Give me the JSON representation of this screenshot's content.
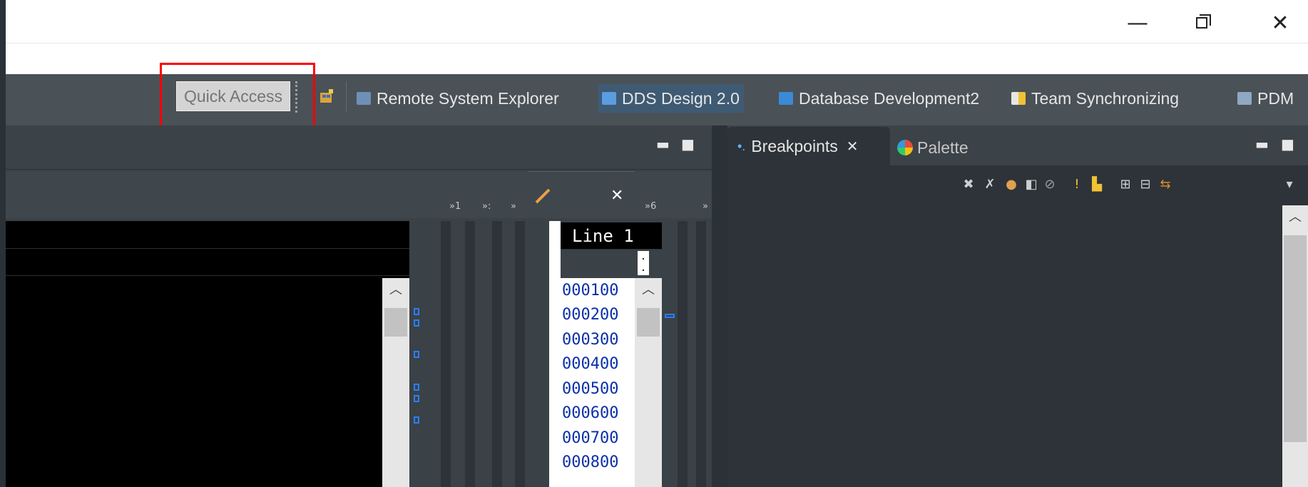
{
  "window": {
    "minimize_glyph": "—",
    "close_glyph": "✕"
  },
  "toolbar": {
    "quick_access_placeholder": "Quick Access",
    "perspectives": [
      {
        "label": "Remote System Explorer",
        "icon": "remote-system-explorer-icon"
      },
      {
        "label": "DDS Design 2.0",
        "icon": "dds-design-icon",
        "active": true
      },
      {
        "label": "Database Development2",
        "icon": "database-development-icon"
      },
      {
        "label": "Team Synchronizing",
        "icon": "team-synchronizing-icon"
      },
      {
        "label": "PDM",
        "icon": "pdm-icon"
      }
    ]
  },
  "editor": {
    "minimize_glyph": "▬",
    "maximize_glyph": "■",
    "minimized_tab_labels": [
      "»1",
      "»:",
      "»",
      "»6",
      "»"
    ]
  },
  "line_view": {
    "header": "Line 1",
    "dots": ". .",
    "lines": [
      "000100",
      "000200",
      "000300",
      "000400",
      "000500",
      "000600",
      "000700",
      "000800"
    ],
    "close_glyph": "✕"
  },
  "breakpoints_panel": {
    "tabs": [
      {
        "label": "Breakpoints",
        "active": true
      },
      {
        "label": "Palette",
        "active": false
      }
    ],
    "close_glyph": "✕"
  },
  "colors": {
    "red_highlight": "#ff0000",
    "active_perspective_bg": "#3f5a73",
    "line_number_text": "#0a2fa8"
  }
}
